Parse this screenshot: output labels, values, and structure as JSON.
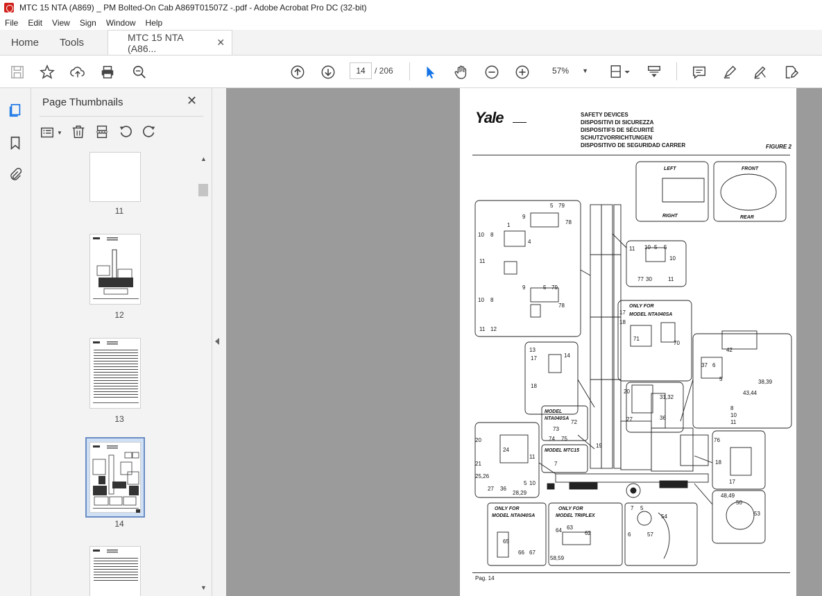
{
  "window": {
    "title": "MTC 15 NTA  (A869) _ PM Bolted-On Cab A869T01507Z -.pdf - Adobe Acrobat Pro DC (32-bit)"
  },
  "menu": [
    "File",
    "Edit",
    "View",
    "Sign",
    "Window",
    "Help"
  ],
  "tabs": {
    "home": "Home",
    "tools": "Tools",
    "document": "MTC 15 NTA  (A86..."
  },
  "toolbar": {
    "current_page": "14",
    "total_pages": "/ 206",
    "zoom": "57%"
  },
  "panel": {
    "title": "Page Thumbnails",
    "thumbnails": [
      {
        "label": "11"
      },
      {
        "label": "12"
      },
      {
        "label": "13"
      },
      {
        "label": "14",
        "selected": true
      },
      {
        "label": ""
      }
    ]
  },
  "document_page": {
    "brand": "Yale",
    "header_lines": [
      "SAFETY DEVICES",
      "DISPOSITIVI DI SICUREZZA",
      "DISPOSITIFS DE SÉCURITÉ",
      "SCHUTZVORRICHTUNGEN",
      "DISPOSITIVO DE SEGURIDAD CARRER"
    ],
    "figure": "FIGURE 2",
    "footer": "Pag. 14",
    "diagram_labels": {
      "left": "LEFT",
      "right": "RIGHT",
      "front": "FRONT",
      "rear": "REAR",
      "only_for": "ONLY    FOR",
      "model_nta040sa": "MODEL  NTA040SA",
      "model_nta040sa_short": "MODEL NTA040SA",
      "model_mtc15": "MODEL  MTC15",
      "model_triplex": "MODEL  TRIPLEX"
    }
  },
  "colors": {
    "accent": "#1473e6",
    "viewer_bg": "#9b9b9b",
    "panel_bg": "#f3f3f3"
  }
}
